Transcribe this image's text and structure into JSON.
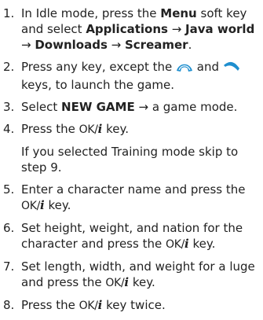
{
  "steps": [
    {
      "num": "1.",
      "p1": "In Idle mode, press the ",
      "k1": "Menu",
      "p2": " soft key and select ",
      "k2": "Applications",
      "a1": " → ",
      "k3": "Java world",
      "a2": " → ",
      "k4": "Downloads",
      "a3": " → ",
      "k5": "Screamer",
      "p3": "."
    },
    {
      "num": "2.",
      "p1": "Press any key, except the ",
      "icon1": "end-call-key-icon",
      "p2": " and ",
      "icon2": "call-key-icon",
      "p3": " keys, to launch the game."
    },
    {
      "num": "3.",
      "p1": "Select ",
      "k1": "NEW GAME",
      "a1": " → ",
      "p2": "a game mode."
    },
    {
      "num": "4.",
      "p1": "Press the ",
      "ok": "OK/",
      "i": "i",
      "p2": " key.",
      "note": "If you selected Training mode skip to step 9."
    },
    {
      "num": "5.",
      "p1": "Enter a character name and press the ",
      "ok": "OK/",
      "i": "i",
      "p2": " key."
    },
    {
      "num": "6.",
      "p1": "Set height, weight, and nation for the character and press the ",
      "ok": "OK/",
      "i": "i",
      "p2": " key."
    },
    {
      "num": "7.",
      "p1": "Set length, width, and weight for a luge and press the ",
      "ok": "OK/",
      "i": "i",
      "p2": " key."
    },
    {
      "num": "8.",
      "p1": "Press the ",
      "ok": "OK/",
      "i": "i",
      "p2": " key twice."
    }
  ],
  "colors": {
    "text": "#222222",
    "end_key_icon": "#1f8fcf",
    "call_key_icon": "#1f8fcf"
  }
}
